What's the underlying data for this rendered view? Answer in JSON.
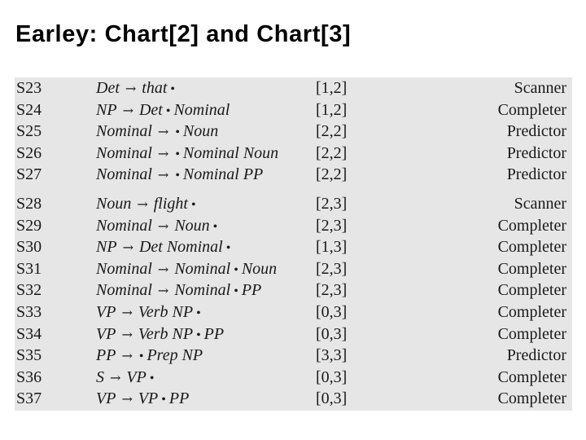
{
  "title": "Earley: Chart[2] and Chart[3]",
  "symbols": {
    "arrow": "→",
    "dot": "•"
  },
  "chart_groups": [
    {
      "name": "Chart[2]",
      "states": [
        {
          "id": "S23",
          "lhs": "Det",
          "before_dot": "that",
          "after_dot": "",
          "span": "[1,2]",
          "operation": "Scanner"
        },
        {
          "id": "S24",
          "lhs": "NP",
          "before_dot": "Det",
          "after_dot": "Nominal",
          "span": "[1,2]",
          "operation": "Completer"
        },
        {
          "id": "S25",
          "lhs": "Nominal",
          "before_dot": "",
          "after_dot": "Noun",
          "span": "[2,2]",
          "operation": "Predictor"
        },
        {
          "id": "S26",
          "lhs": "Nominal",
          "before_dot": "",
          "after_dot": "Nominal Noun",
          "span": "[2,2]",
          "operation": "Predictor"
        },
        {
          "id": "S27",
          "lhs": "Nominal",
          "before_dot": "",
          "after_dot": "Nominal PP",
          "span": "[2,2]",
          "operation": "Predictor"
        }
      ]
    },
    {
      "name": "Chart[3]",
      "states": [
        {
          "id": "S28",
          "lhs": "Noun",
          "before_dot": "flight",
          "after_dot": "",
          "span": "[2,3]",
          "operation": "Scanner"
        },
        {
          "id": "S29",
          "lhs": "Nominal",
          "before_dot": "Noun",
          "after_dot": "",
          "span": "[2,3]",
          "operation": "Completer"
        },
        {
          "id": "S30",
          "lhs": "NP",
          "before_dot": "Det Nominal",
          "after_dot": "",
          "span": "[1,3]",
          "operation": "Completer"
        },
        {
          "id": "S31",
          "lhs": "Nominal",
          "before_dot": "Nominal",
          "after_dot": "Noun",
          "span": "[2,3]",
          "operation": "Completer"
        },
        {
          "id": "S32",
          "lhs": "Nominal",
          "before_dot": "Nominal",
          "after_dot": "PP",
          "span": "[2,3]",
          "operation": "Completer"
        },
        {
          "id": "S33",
          "lhs": "VP",
          "before_dot": "Verb NP",
          "after_dot": "",
          "span": "[0,3]",
          "operation": "Completer"
        },
        {
          "id": "S34",
          "lhs": "VP",
          "before_dot": "Verb NP",
          "after_dot": "PP",
          "span": "[0,3]",
          "operation": "Completer"
        },
        {
          "id": "S35",
          "lhs": "PP",
          "before_dot": "",
          "after_dot": "Prep NP",
          "span": "[3,3]",
          "operation": "Predictor"
        },
        {
          "id": "S36",
          "lhs": "S",
          "before_dot": "VP",
          "after_dot": "",
          "span": "[0,3]",
          "operation": "Completer"
        },
        {
          "id": "S37",
          "lhs": "VP",
          "before_dot": "VP",
          "after_dot": "PP",
          "span": "[0,3]",
          "operation": "Completer"
        }
      ]
    }
  ]
}
